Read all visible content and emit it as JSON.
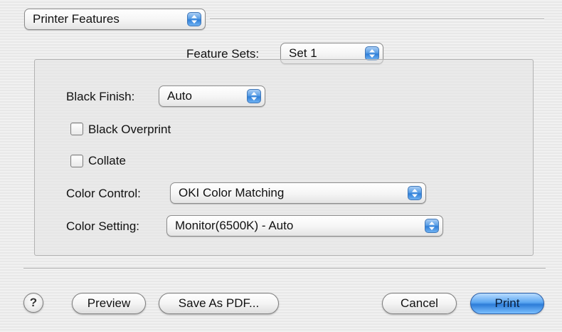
{
  "panel_menu": {
    "value": "Printer Features"
  },
  "feature_sets": {
    "label": "Feature Sets:",
    "value": "Set 1"
  },
  "black_finish": {
    "label": "Black Finish:",
    "value": "Auto"
  },
  "black_overprint": {
    "label": "Black Overprint",
    "checked": false
  },
  "collate": {
    "label": "Collate",
    "checked": false
  },
  "color_control": {
    "label": "Color Control:",
    "value": "OKI Color Matching"
  },
  "color_setting": {
    "label": "Color Setting:",
    "value": "Monitor(6500K) - Auto"
  },
  "buttons": {
    "help": "?",
    "preview": "Preview",
    "save_as_pdf": "Save As PDF...",
    "cancel": "Cancel",
    "print": "Print"
  },
  "icons": {
    "popup_arrows": "up-down-arrows-icon",
    "help": "question-mark-icon"
  },
  "colors": {
    "accent_blue": "#2f7fd8",
    "window_background": "#ececec"
  }
}
